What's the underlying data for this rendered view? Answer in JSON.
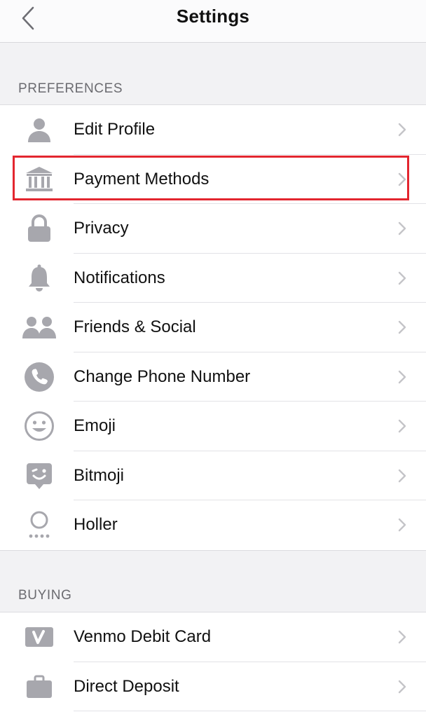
{
  "header": {
    "title": "Settings"
  },
  "sections": [
    {
      "title": "PREFERENCES",
      "items": [
        {
          "label": "Edit Profile",
          "icon": "person-icon"
        },
        {
          "label": "Payment Methods",
          "icon": "bank-icon"
        },
        {
          "label": "Privacy",
          "icon": "lock-icon"
        },
        {
          "label": "Notifications",
          "icon": "bell-icon"
        },
        {
          "label": "Friends & Social",
          "icon": "friends-icon"
        },
        {
          "label": "Change Phone Number",
          "icon": "phone-icon"
        },
        {
          "label": "Emoji",
          "icon": "smiley-icon"
        },
        {
          "label": "Bitmoji",
          "icon": "bitmoji-icon"
        },
        {
          "label": "Holler",
          "icon": "holler-icon"
        }
      ]
    },
    {
      "title": "BUYING",
      "items": [
        {
          "label": "Venmo Debit Card",
          "icon": "venmo-card-icon"
        },
        {
          "label": "Direct Deposit",
          "icon": "briefcase-icon"
        }
      ]
    }
  ],
  "highlight": {
    "target": "Payment Methods",
    "color": "#e3262f"
  },
  "colors": {
    "icon": "#a7a7ad",
    "chevron": "#c4c4c8",
    "back": "#6e6e74"
  }
}
